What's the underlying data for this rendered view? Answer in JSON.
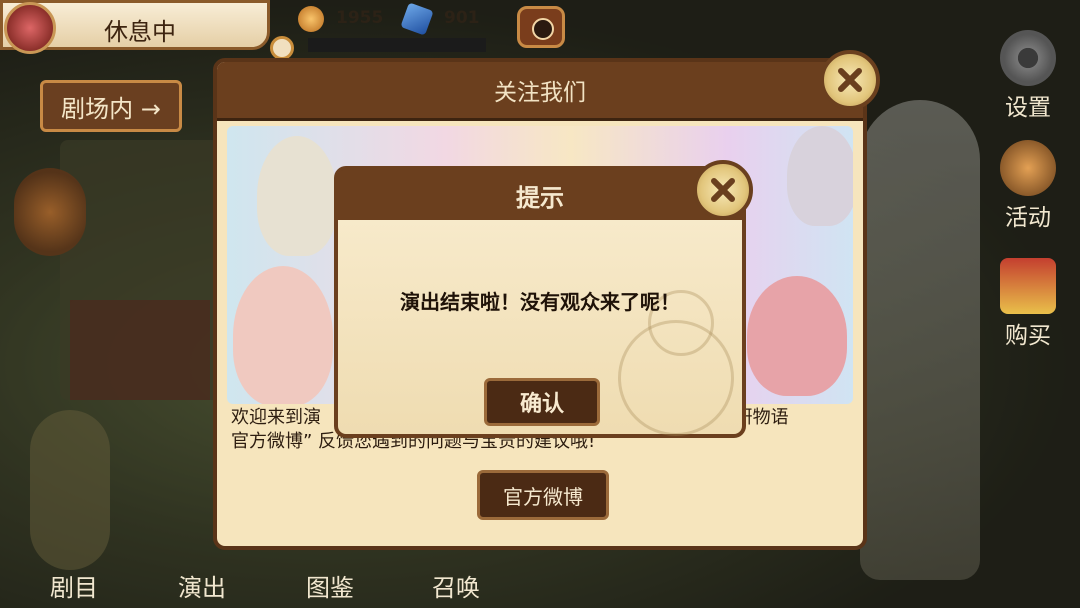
{
  "hud": {
    "status": "休息中",
    "coins": "1955",
    "gems": "901",
    "theater_button": "剧场内 →"
  },
  "side_menu": {
    "settings": "设置",
    "events": "活动",
    "shop": "购买"
  },
  "bottom_menu": {
    "repertoire": "剧目",
    "perform": "演出",
    "gallery": "图鉴",
    "summon": "召唤"
  },
  "follow_panel": {
    "title": "关注我们",
    "text_line1": "欢迎来到演                                                                  宝石研物语",
    "text_line2": "官方微博” 反馈您遇到的问题与宝贵的建议哦!",
    "weibo_button": "官方微博"
  },
  "prompt": {
    "title": "提示",
    "message": "演出结束啦！没有观众来了呢！",
    "confirm": "确认"
  },
  "colors": {
    "panel_brown": "#6b3f1e",
    "panel_cream": "#f6e5bd",
    "close_gold": "#e2c67c"
  }
}
